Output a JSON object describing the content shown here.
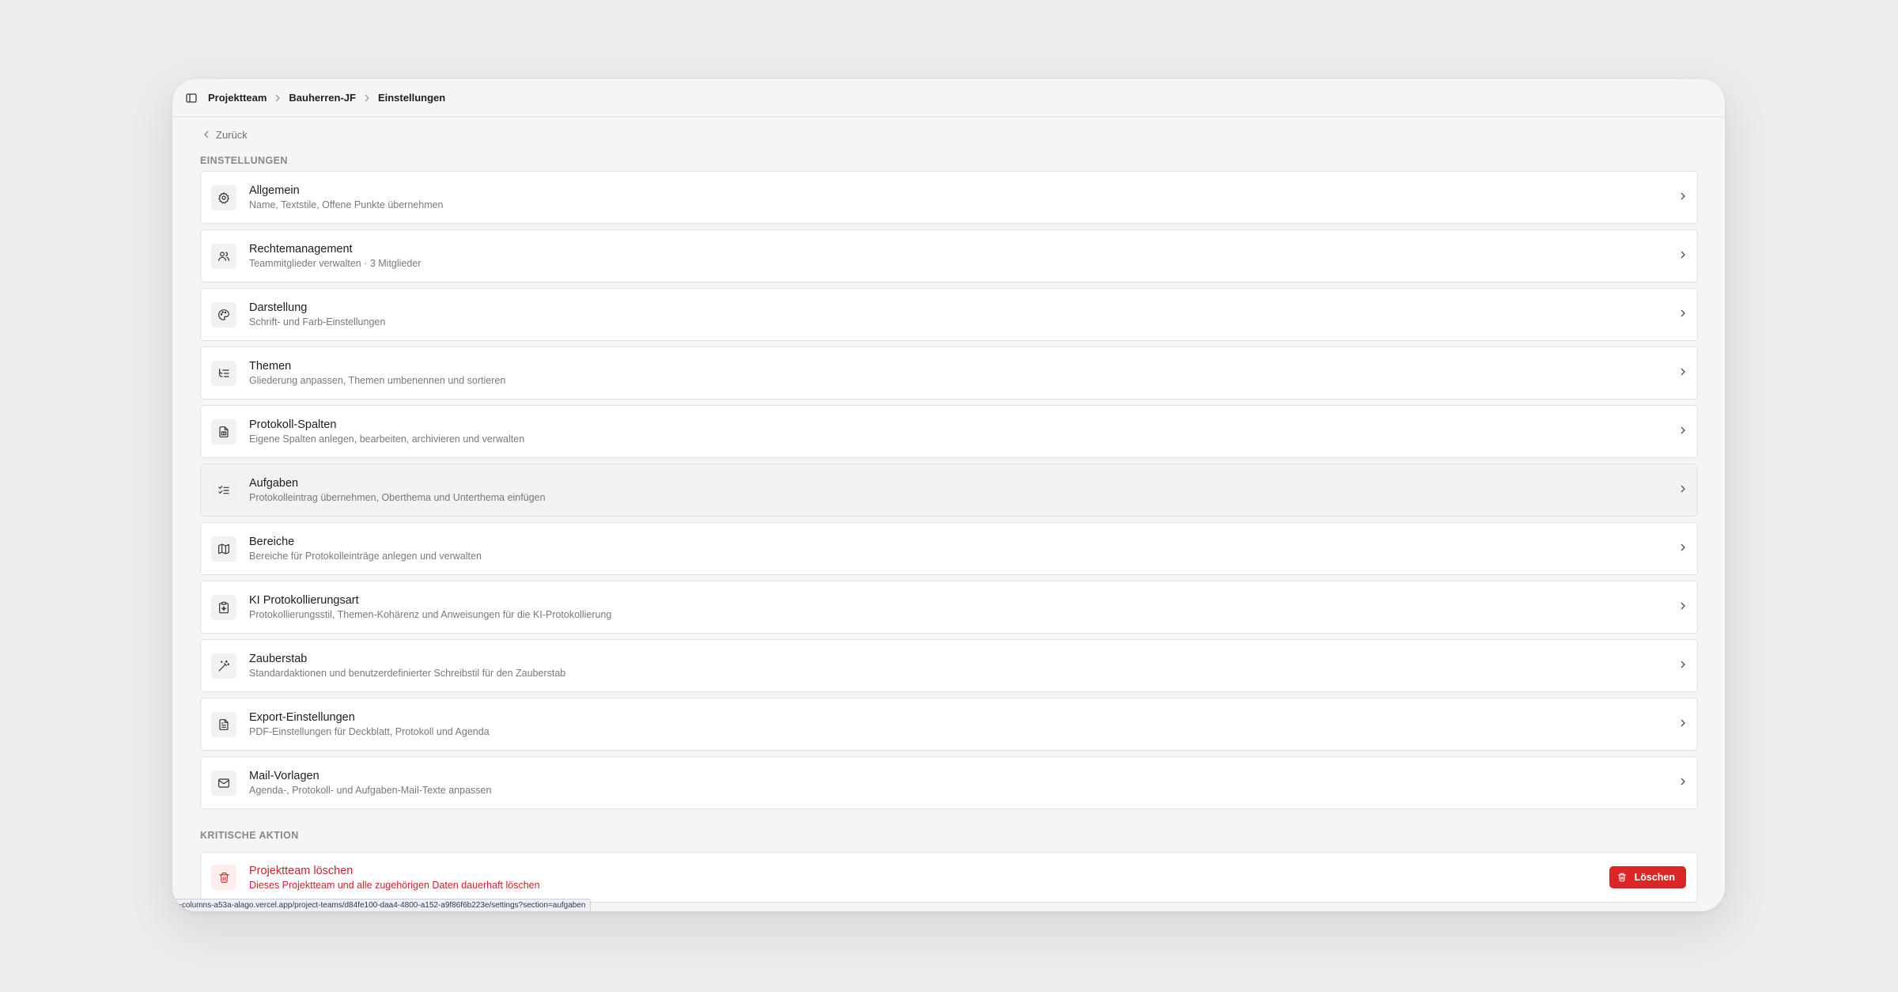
{
  "breadcrumb": {
    "items": [
      "Projektteam",
      "Bauherren-JF",
      "Einstellungen"
    ]
  },
  "back_label": "Zurück",
  "section_label": "EINSTELLUNGEN",
  "settings": [
    {
      "icon": "gear-icon",
      "title": "Allgemein",
      "subtitle": "Name, Textstile, Offene Punkte übernehmen"
    },
    {
      "icon": "users-icon",
      "title": "Rechtemanagement",
      "subtitle": "Teammitglieder verwalten · 3 Mitglieder"
    },
    {
      "icon": "palette-icon",
      "title": "Darstellung",
      "subtitle": "Schrift- und Farb-Einstellungen"
    },
    {
      "icon": "list-tree-icon",
      "title": "Themen",
      "subtitle": "Gliederung anpassen, Themen umbenennen und sortieren"
    },
    {
      "icon": "file-spreadsheet-icon",
      "title": "Protokoll-Spalten",
      "subtitle": "Eigene Spalten anlegen, bearbeiten, archivieren und verwalten"
    },
    {
      "icon": "list-checks-icon",
      "title": "Aufgaben",
      "subtitle": "Protokolleintrag übernehmen, Oberthema und Unterthema einfügen"
    },
    {
      "icon": "map-icon",
      "title": "Bereiche",
      "subtitle": "Bereiche für Protokolleinträge anlegen und verwalten"
    },
    {
      "icon": "clipboard-ai-icon",
      "title": "KI Protokollierungsart",
      "subtitle": "Protokollierungsstil, Themen-Kohärenz und Anweisungen für die KI-Protokollierung"
    },
    {
      "icon": "magic-wand-icon",
      "title": "Zauberstab",
      "subtitle": "Standardaktionen und benutzerdefinierter Schreibstil für den Zauberstab"
    },
    {
      "icon": "file-text-icon",
      "title": "Export-Einstellungen",
      "subtitle": "PDF-Einstellungen für Deckblatt, Protokoll und Agenda"
    },
    {
      "icon": "mail-icon",
      "title": "Mail-Vorlagen",
      "subtitle": "Agenda-, Protokoll- und Aufgaben-Mail-Texte anpassen"
    }
  ],
  "critical": {
    "label": "KRITISCHE AKTION",
    "title": "Projektteam löschen",
    "subtitle": "Dieses Projektteam und alle zugehörigen Daten dauerhaft löschen",
    "button_label": "Löschen"
  },
  "status_url": "~columns-a53a-alago.vercel.app/project-teams/d84fe100-daa4-4800-a152-a9f86f6b223e/settings?section=aufgaben",
  "colors": {
    "danger": "#dc2626",
    "background": "#f6f5f3"
  }
}
